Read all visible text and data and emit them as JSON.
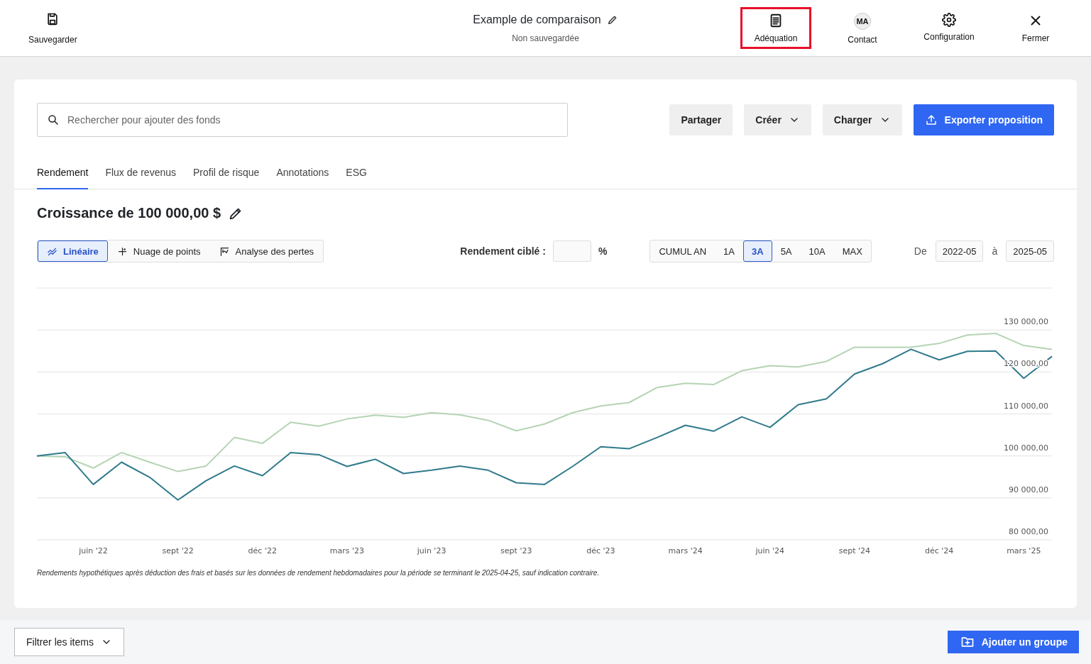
{
  "header": {
    "save": {
      "label": "Sauvegarder"
    },
    "title": "Example de comparaison",
    "subtitle": "Non sauvegardée",
    "nav": [
      {
        "kind": "document",
        "label": "Adéquation",
        "highlighted": true
      },
      {
        "kind": "avatar",
        "initials": "MA",
        "label": "Contact",
        "highlighted": false
      },
      {
        "kind": "gear",
        "label": "Configuration",
        "highlighted": false
      },
      {
        "kind": "close",
        "label": "Fermer",
        "highlighted": false
      }
    ]
  },
  "search": {
    "placeholder": "Rechercher pour ajouter des fonds"
  },
  "actions": [
    {
      "kind": "plain",
      "label": "Partager"
    },
    {
      "kind": "dropdown",
      "label": "Créer"
    },
    {
      "kind": "dropdown",
      "label": "Charger"
    },
    {
      "kind": "primary",
      "label": "Exporter proposition"
    }
  ],
  "tabs": [
    {
      "label": "Rendement",
      "selected": true
    },
    {
      "label": "Flux de revenus",
      "selected": false
    },
    {
      "label": "Profil de risque",
      "selected": false
    },
    {
      "label": "Annotations",
      "selected": false
    },
    {
      "label": "ESG",
      "selected": false
    }
  ],
  "heading": "Croissance de 100 000,00 $",
  "chart_types": [
    {
      "kind": "line",
      "label": "Linéaire",
      "selected": true
    },
    {
      "kind": "scatter",
      "label": "Nuage de points",
      "selected": false
    },
    {
      "kind": "drawdown",
      "label": "Analyse des pertes",
      "selected": false
    }
  ],
  "target": {
    "label": "Rendement ciblé :",
    "unit": "%"
  },
  "ranges": [
    {
      "label": "CUMUL AN",
      "selected": false
    },
    {
      "label": "1A",
      "selected": false
    },
    {
      "label": "3A",
      "selected": true
    },
    {
      "label": "5A",
      "selected": false
    },
    {
      "label": "10A",
      "selected": false
    },
    {
      "label": "MAX",
      "selected": false
    }
  ],
  "dates": {
    "from_label": "De",
    "from": "2022-05",
    "to_label": "à",
    "to": "2025-05"
  },
  "chart_data": {
    "type": "line",
    "categories": [
      null,
      null,
      "juin '22",
      null,
      null,
      "sept '22",
      null,
      null,
      "déc '22",
      null,
      null,
      "mars '23",
      null,
      null,
      "juin '23",
      null,
      null,
      "sept '23",
      null,
      null,
      "déc '23",
      null,
      null,
      "mars '24",
      null,
      null,
      "juin '24",
      null,
      null,
      "sept '24",
      null,
      null,
      "déc '24",
      null,
      null,
      "mars '25",
      null
    ],
    "ylim": [
      80000,
      140000
    ],
    "grid": true,
    "yticks": [
      {
        "value": 80000,
        "label": "80 000,00"
      },
      {
        "value": 90000,
        "label": "90 000,00"
      },
      {
        "value": 100000,
        "label": "100 000,00"
      },
      {
        "value": 110000,
        "label": "110 000,00"
      },
      {
        "value": 120000,
        "label": "120 000,00"
      },
      {
        "value": 130000,
        "label": "130 000,00"
      }
    ],
    "series": [
      {
        "color": "#b5d4b4",
        "values": [
          100000,
          99800,
          97100,
          100800,
          98500,
          96300,
          97600,
          104400,
          103000,
          108000,
          107100,
          108800,
          109700,
          109200,
          110300,
          109800,
          108500,
          106000,
          107600,
          110300,
          111900,
          112700,
          116300,
          117300,
          117000,
          120300,
          121500,
          121200,
          122500,
          125900,
          125900,
          125900,
          126800,
          128800,
          129200,
          126300,
          125400
        ]
      },
      {
        "color": "#2f7a8c",
        "values": [
          100000,
          100800,
          93200,
          98500,
          94900,
          89500,
          94100,
          97600,
          95300,
          100800,
          100300,
          97500,
          99200,
          95800,
          96600,
          97600,
          96600,
          93600,
          93200,
          97500,
          102200,
          101700,
          104400,
          107300,
          105900,
          109300,
          106800,
          112200,
          113600,
          119500,
          122000,
          125400,
          122900,
          124900,
          125000,
          118500,
          123700
        ]
      }
    ]
  },
  "footnote": "Rendements hypothétiques après déduction des frais et basés sur les données de rendement hebdomadaires pour la période se terminant le 2025-04-25, sauf indication contraire.",
  "footer": {
    "filter": "Filtrer les items",
    "add_group": "Ajouter un groupe"
  }
}
